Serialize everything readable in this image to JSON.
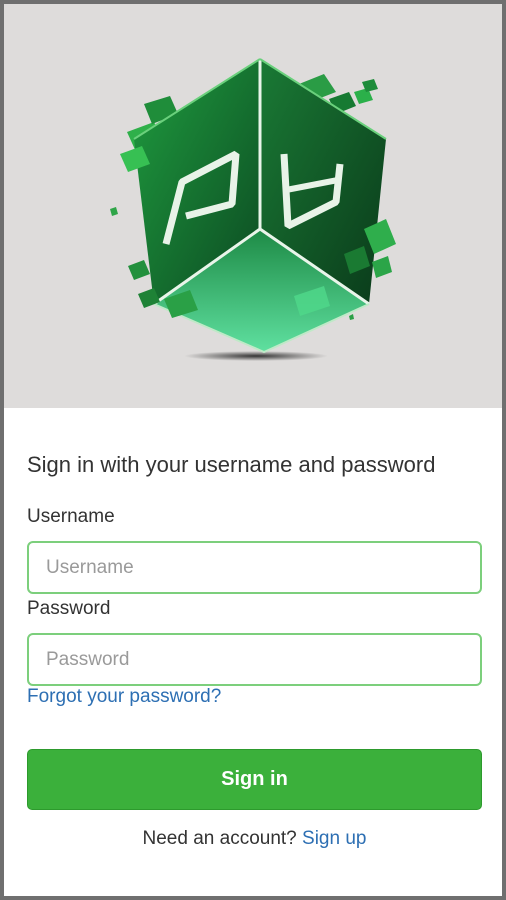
{
  "logo": {
    "name": "cube-logo",
    "colors": {
      "dark_green": "#0b3d1c",
      "mid_green": "#1c8f3c",
      "bright_green": "#34c45a",
      "mint": "#5fe0a0",
      "background": "#dedcdb"
    }
  },
  "form": {
    "heading": "Sign in with your username and password",
    "username_label": "Username",
    "username_placeholder": "Username",
    "username_value": "",
    "password_label": "Password",
    "password_placeholder": "Password",
    "password_value": "",
    "forgot_link": "Forgot your password?",
    "signin_button": "Sign in",
    "footer_text": "Need an account?",
    "signup_link": "Sign up"
  },
  "colors": {
    "accent_button": "#3bb03b",
    "input_border": "#7ccf7c",
    "link": "#2d6fb3"
  }
}
